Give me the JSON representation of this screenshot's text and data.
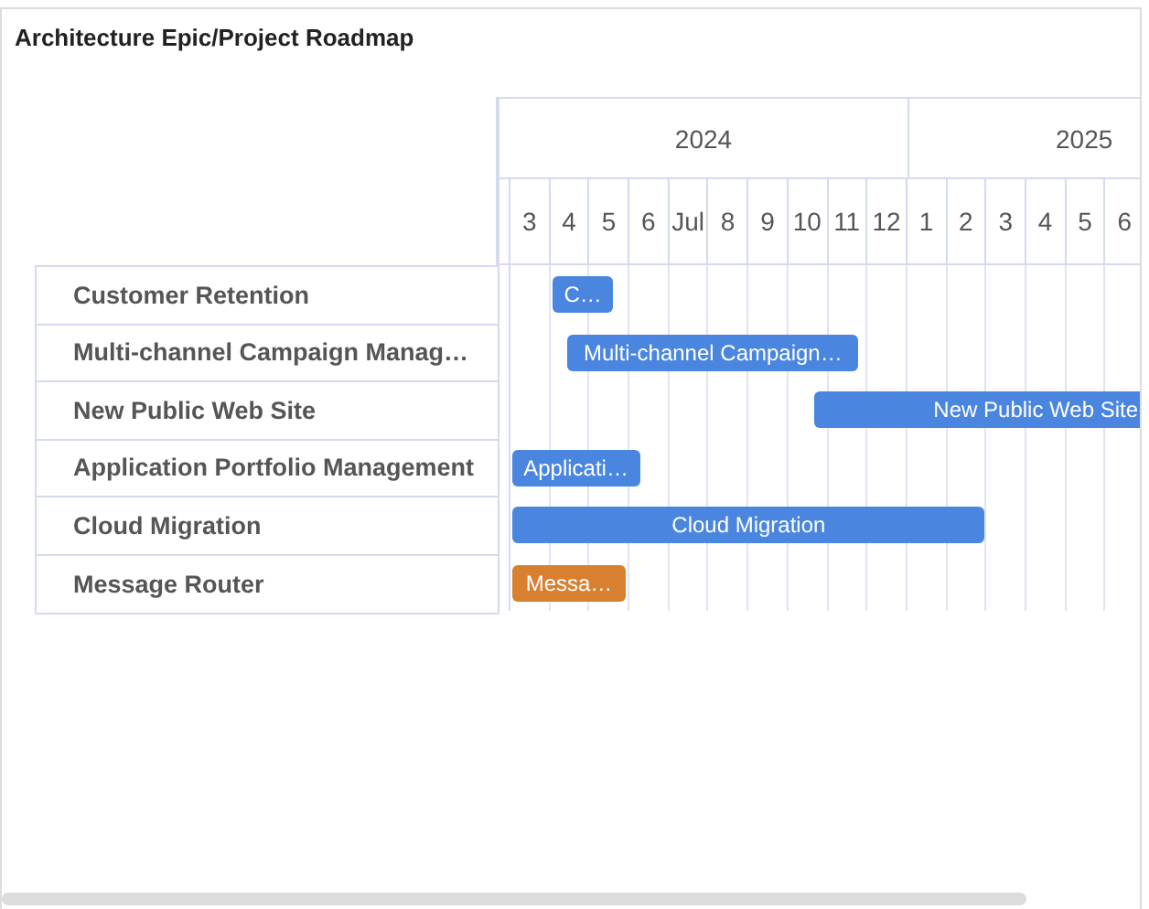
{
  "title": "Architecture Epic/Project Roadmap",
  "timeline": {
    "years": [
      {
        "label": "2024",
        "months": [
          "3",
          "4",
          "5",
          "6",
          "Jul",
          "8",
          "9",
          "10",
          "11",
          "12"
        ]
      },
      {
        "label": "2025",
        "months": [
          "1",
          "2",
          "3",
          "4",
          "5",
          "6"
        ]
      }
    ]
  },
  "rows": [
    {
      "name": "Customer Retention",
      "bar": {
        "label": "C…",
        "color": "#4a86e0",
        "clipped": false
      }
    },
    {
      "name": "Multi-channel Campaign Manag…",
      "bar": {
        "label": "Multi-channel Campaign…",
        "color": "#4a86e0",
        "clipped": false
      }
    },
    {
      "name": "New Public Web Site",
      "bar": {
        "label": "New Public Web Site",
        "color": "#4a86e0",
        "clipped": true
      }
    },
    {
      "name": "Application Portfolio Management",
      "bar": {
        "label": "Applicati…",
        "color": "#4a86e0",
        "clipped": false
      }
    },
    {
      "name": "Cloud Migration",
      "bar": {
        "label": "Cloud Migration",
        "color": "#4a86e0",
        "clipped": false
      }
    },
    {
      "name": "Message Router",
      "bar": {
        "label": "Messa…",
        "color": "#d98030",
        "clipped": false
      }
    }
  ]
}
